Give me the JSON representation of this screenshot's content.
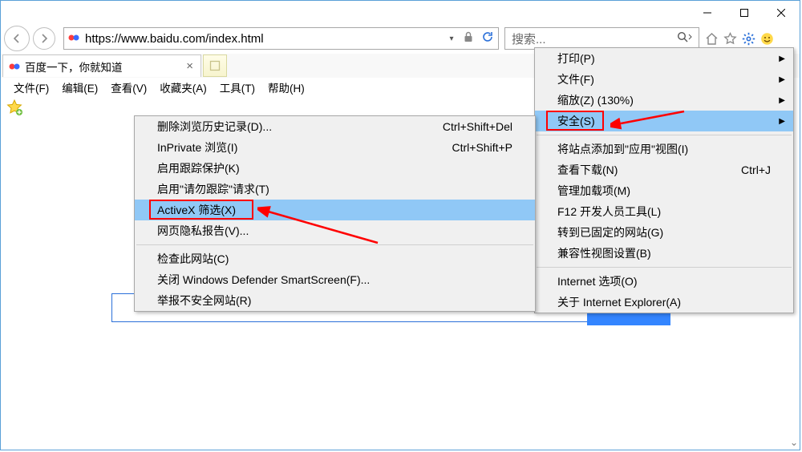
{
  "address": {
    "url": "https://www.baidu.com/index.html"
  },
  "search": {
    "placeholder": "搜索..."
  },
  "tab": {
    "title": "百度一下，你就知道"
  },
  "menubar": {
    "file": "文件(F)",
    "edit": "编辑(E)",
    "view": "查看(V)",
    "fav": "收藏夹(A)",
    "tools": "工具(T)",
    "help": "帮助(H)"
  },
  "tools_menu": {
    "print": "打印(P)",
    "file": "文件(F)",
    "zoom": "缩放(Z) (130%)",
    "security": "安全(S)",
    "add_to_apps": "将站点添加到\"应用\"视图(I)",
    "downloads": {
      "label": "查看下载(N)",
      "shortcut": "Ctrl+J"
    },
    "addons": "管理加载项(M)",
    "f12": "F12 开发人员工具(L)",
    "pinned": "转到已固定的网站(G)",
    "compat": "兼容性视图设置(B)",
    "inetopt": "Internet 选项(O)",
    "about": "关于 Internet Explorer(A)"
  },
  "security_menu": {
    "del_history": {
      "label": "删除浏览历史记录(D)...",
      "shortcut": "Ctrl+Shift+Del"
    },
    "inprivate": {
      "label": "InPrivate 浏览(I)",
      "shortcut": "Ctrl+Shift+P"
    },
    "tracking": "启用跟踪保护(K)",
    "dnt": "启用\"请勿跟踪\"请求(T)",
    "activex": "ActiveX 筛选(X)",
    "privacy": "网页隐私报告(V)...",
    "checksite": "检查此网站(C)",
    "smartscreen": "关闭 Windows Defender SmartScreen(F)...",
    "report": "举报不安全网站(R)"
  }
}
